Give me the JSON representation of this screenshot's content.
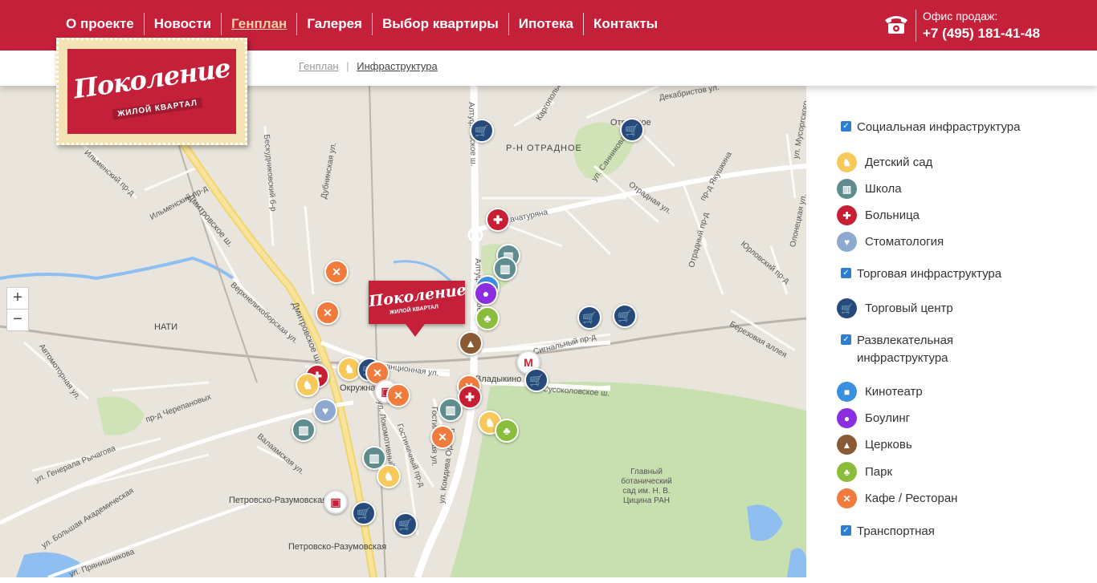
{
  "header": {
    "nav": [
      "О проекте",
      "Новости",
      "Генплан",
      "Галерея",
      "Выбор квартиры",
      "Ипотека",
      "Контакты"
    ],
    "active_index": 2,
    "office_label": "Офис продаж:",
    "phone": "+7 (495) 181-41-48"
  },
  "breadcrumb": {
    "parent": "Генплан",
    "separator": "|",
    "current": "Инфраструктура"
  },
  "logo": {
    "title": "Поколение",
    "subtitle": "ЖИЛОЙ КВАРТАЛ"
  },
  "map": {
    "zoom_in": "+",
    "zoom_out": "−",
    "labels": [
      "Дмитровское ш.",
      "Дмитровское ш.",
      "Ильменский пр-д",
      "Ильменский пр-д",
      "Бескудниковский б-р",
      "Дубнинская ул.",
      "Верхнелихоборская ул.",
      "Автомоторная ул.",
      "пр-д Черепановых",
      "ул. Генерала Рычагова",
      "Валаамская ул.",
      "ул. Большая Академическая",
      "ул. Прянишникова",
      "Петровско-Разумовская",
      "Петровско-Разумовская",
      "Окружная",
      "Станционная ул.",
      "ул. Локомотивный пр.",
      "Гостиничный пр-д",
      "Гостиничная ул.",
      "Алтуфьевское ш.",
      "Алтуфьевское ш.",
      "ул. Комдива Орлова",
      "Сигнальный пр-д",
      "Владыкино",
      "Сусоколовское ш.",
      "Главный ботанический сад им. Н. В. Цицина РАН",
      "Р-Н ОТРАДНОЕ",
      "Отрадное",
      "ул. Хачатуряна",
      "Декабристов ул.",
      "Каргопольская ул.",
      "ул. Санникова",
      "Отрадная ул.",
      "пр-д Якушкина",
      "Отрадный пр-д",
      "Юрловский пр-д",
      "Березовая аллея",
      "Олонецкая ул.",
      "ул. Мусоргского",
      "НАТИ"
    ],
    "marker": {
      "title": "Поколение",
      "subtitle": "ЖИЛОЙ КВАРТАЛ"
    }
  },
  "legend": {
    "groups": [
      {
        "label": "Социальная инфраструктура",
        "checked": true,
        "items": [
          {
            "label": "Детский сад",
            "color": "#f7c95b",
            "icon": "horse-icon"
          },
          {
            "label": "Школа",
            "color": "#5e8c8f",
            "icon": "book-icon"
          },
          {
            "label": "Больница",
            "color": "#c81e33",
            "icon": "cross-icon"
          },
          {
            "label": "Стоматология",
            "color": "#8ea9cf",
            "icon": "tooth-icon"
          }
        ]
      },
      {
        "label": "Торговая инфраструктура",
        "checked": true,
        "items": [
          {
            "label": "Торговый центр",
            "color": "#274a7d",
            "icon": "cart-icon"
          }
        ]
      },
      {
        "label": "Развлекательная инфраструктура",
        "checked": true,
        "items": [
          {
            "label": "Кинотеатр",
            "color": "#3b8fe0",
            "icon": "camera-icon"
          },
          {
            "label": "Боулинг",
            "color": "#8a2ee0",
            "icon": "bowling-icon"
          },
          {
            "label": "Церковь",
            "color": "#8a5a34",
            "icon": "church-icon"
          },
          {
            "label": "Парк",
            "color": "#8bbd3c",
            "icon": "tree-icon"
          },
          {
            "label": "Кафе / Ресторан",
            "color": "#f07b3c",
            "icon": "fork-knife-icon"
          }
        ]
      },
      {
        "label": "Транспортная",
        "checked": true,
        "items": []
      }
    ]
  }
}
